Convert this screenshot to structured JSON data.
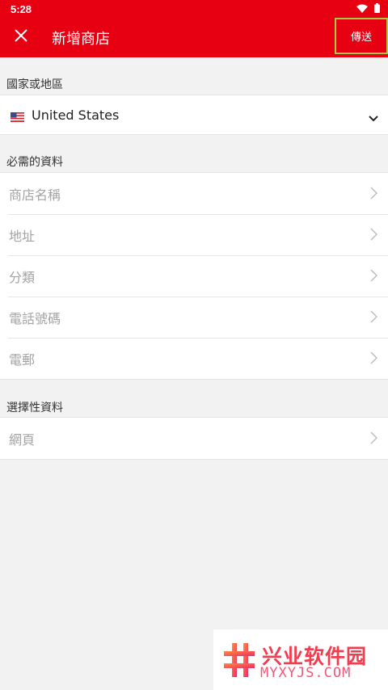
{
  "status_bar": {
    "time": "5:28"
  },
  "toolbar": {
    "title": "新增商店",
    "send_label": "傳送"
  },
  "country_section": {
    "header": "國家或地區",
    "selected_country": "United States"
  },
  "required_section": {
    "header": "必需的資料",
    "fields": [
      {
        "label": "商店名稱"
      },
      {
        "label": "地址"
      },
      {
        "label": "分類"
      },
      {
        "label": "電話號碼"
      },
      {
        "label": "電郵"
      }
    ]
  },
  "optional_section": {
    "header": "選擇性資料",
    "fields": [
      {
        "label": "網頁"
      }
    ]
  },
  "watermark": {
    "title": "兴业软件园",
    "subtitle": "MYXYJS.COM"
  },
  "colors": {
    "brand_red": "#e60012",
    "send_border": "#a6c94a"
  }
}
